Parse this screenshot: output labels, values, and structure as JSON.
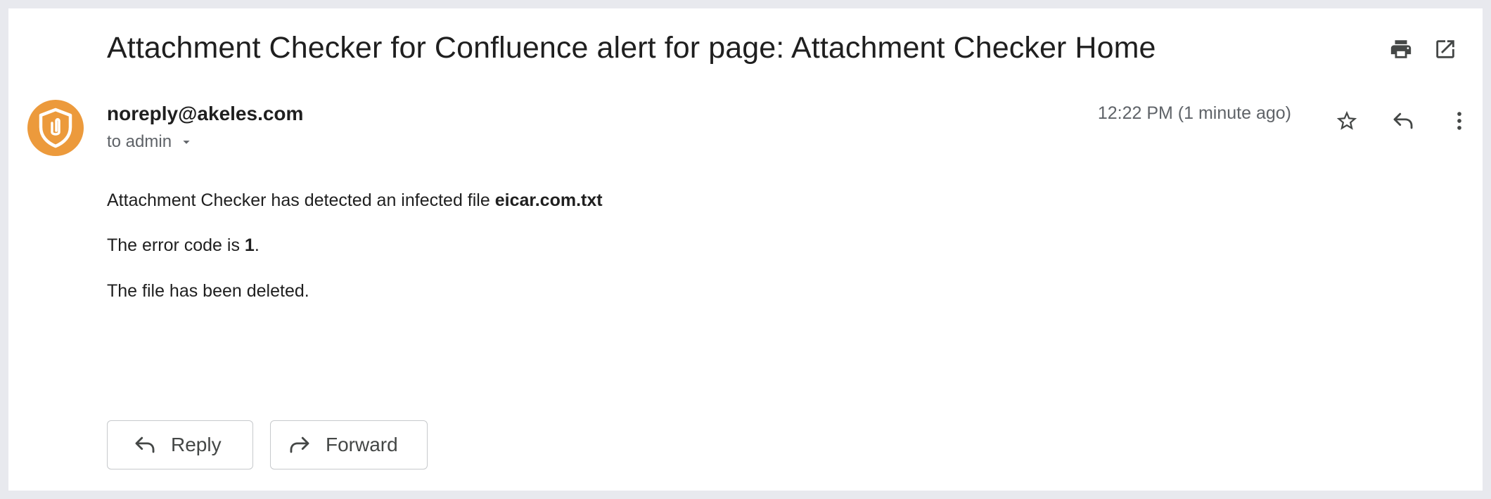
{
  "email": {
    "subject": "Attachment Checker for Confluence alert for page: Attachment Checker Home",
    "sender": "noreply@akeles.com",
    "recipient_label": "to admin",
    "timestamp": "12:22 PM (1 minute ago)",
    "body": {
      "line1_prefix": "Attachment Checker has detected an infected file ",
      "infected_file": "eicar.com.txt",
      "line2_prefix": "The error code is ",
      "error_code": "1",
      "line2_suffix": ".",
      "line3": "The file has been deleted."
    }
  },
  "actions": {
    "reply_label": "Reply",
    "forward_label": "Forward"
  },
  "icons": {
    "print": "print-icon",
    "open_in_new": "open-in-new-window-icon",
    "star": "star-icon",
    "reply": "reply-icon",
    "more": "more-vert-icon",
    "dropdown": "arrow-drop-down-icon",
    "avatar": "shield-paperclip-icon"
  },
  "colors": {
    "avatar_bg": "#ec9a3c",
    "text_primary": "#1f1f1f",
    "text_secondary": "#5f6368",
    "page_bg": "#e8e9ee"
  }
}
